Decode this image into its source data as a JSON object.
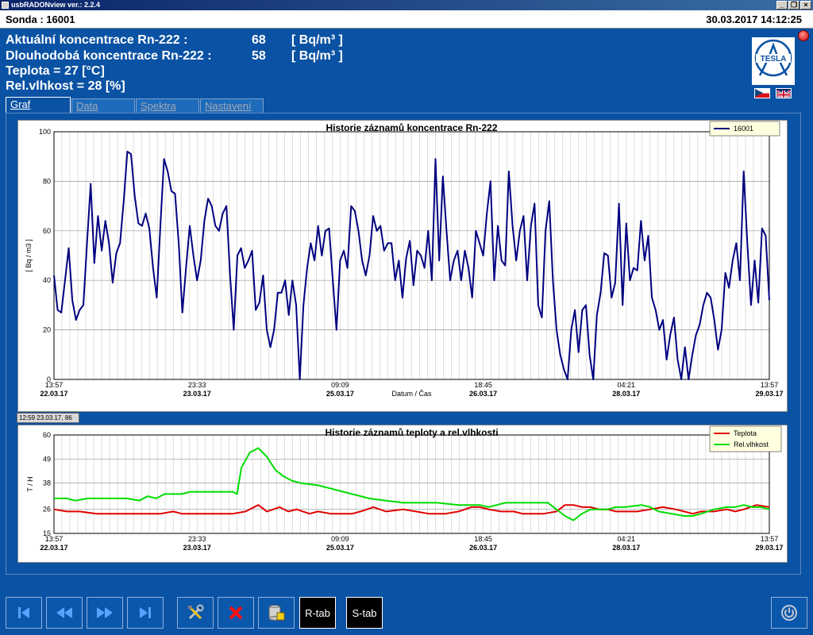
{
  "window": {
    "title": "usbRADONview ver.: 2.2.4",
    "min": "_",
    "restore": "❐",
    "close": "×"
  },
  "info": {
    "sonda": "Sonda : 16001",
    "datetime": "30.03.2017 14:12:25"
  },
  "readings": {
    "rn_actual": {
      "label": "Aktuální koncentrace Rn-222 :",
      "value": "68",
      "unit": "[ Bq/m³ ]"
    },
    "rn_longterm": {
      "label": "Dlouhodobá koncentrace Rn-222 :",
      "value": "58",
      "unit": "[ Bq/m³ ]"
    },
    "temperature": "Teplota = 27  [°C]",
    "humidity": "Rel.vlhkost = 28  [%]"
  },
  "logo": {
    "text": "TESLA"
  },
  "tabs": [
    {
      "label": "Graf",
      "active": true
    },
    {
      "label": "Data",
      "active": false
    },
    {
      "label": "Spektra",
      "active": false
    },
    {
      "label": "Nastavení",
      "active": false
    }
  ],
  "status_readout": "12:59 23.03.17, 86",
  "buttons": {
    "r_tab": "R-tab",
    "s_tab": "S-tab"
  },
  "colors": {
    "panel": "#0a52a3",
    "radon_line": "#000080",
    "temp_line": "#e00000",
    "hum_line": "#00dd00"
  },
  "chart_data": [
    {
      "type": "line",
      "title": "Historie záznamů koncentrace Rn-222",
      "ylabel": "[ Bq / m3 ]",
      "xlabel": "Datum / Čas",
      "ylim": [
        0,
        100
      ],
      "yticks": [
        0,
        20,
        40,
        60,
        80,
        100
      ],
      "xlim": [
        0,
        168
      ],
      "xticks": [
        {
          "pos": 0,
          "time": "13:57",
          "date": "22.03.17"
        },
        {
          "pos": 33.6,
          "time": "23:33",
          "date": "23.03.17"
        },
        {
          "pos": 67.2,
          "time": "09:09",
          "date": "25.03.17"
        },
        {
          "pos": 100.8,
          "time": "18:45",
          "date": "26.03.17"
        },
        {
          "pos": 134.4,
          "time": "04:21",
          "date": "28.03.17"
        },
        {
          "pos": 168,
          "time": "13:57",
          "date": "29.03.17"
        }
      ],
      "legend": "top-right",
      "grid": true,
      "series": [
        {
          "name": "16001",
          "color": "#000080",
          "values": [
            42,
            28,
            27,
            40,
            53,
            32,
            24,
            28,
            30,
            55,
            79,
            47,
            66,
            52,
            64,
            55,
            39,
            51,
            55,
            72,
            92,
            91,
            74,
            63,
            62,
            67,
            61,
            45,
            33,
            62,
            89,
            84,
            76,
            75,
            55,
            27,
            45,
            62,
            50,
            40,
            48,
            64,
            73,
            70,
            62,
            60,
            67,
            70,
            42,
            20,
            50,
            53,
            45,
            48,
            52,
            28,
            31,
            42,
            20,
            13,
            20,
            35,
            35,
            40,
            26,
            40,
            30,
            0,
            30,
            45,
            55,
            48,
            62,
            50,
            60,
            61,
            40,
            20,
            48,
            52,
            45,
            70,
            68,
            60,
            48,
            42,
            50,
            66,
            60,
            62,
            52,
            55,
            55,
            40,
            48,
            33,
            49,
            56,
            38,
            52,
            50,
            45,
            60,
            40,
            89,
            48,
            82,
            60,
            40,
            48,
            52,
            40,
            52,
            45,
            33,
            60,
            55,
            50,
            67,
            80,
            40,
            62,
            48,
            46,
            84,
            62,
            48,
            60,
            66,
            40,
            62,
            71,
            30,
            25,
            60,
            72,
            40,
            20,
            10,
            4,
            0,
            20,
            28,
            11,
            28,
            30,
            10,
            0,
            26,
            35,
            51,
            50,
            33,
            39,
            71,
            30,
            63,
            40,
            45,
            44,
            64,
            48,
            58,
            33,
            28,
            20,
            24,
            8,
            18,
            25,
            8,
            0,
            13,
            0,
            10,
            18,
            22,
            30,
            35,
            33,
            24,
            12,
            20,
            43,
            37,
            48,
            55,
            40,
            84,
            55,
            30,
            48,
            31,
            61,
            58,
            32
          ]
        }
      ]
    },
    {
      "type": "line",
      "title": "Historie záznamů teploty a rel.vlhkosti",
      "ylabel": "T / H",
      "ylim": [
        15,
        60
      ],
      "yticks": [
        15,
        26,
        38,
        49,
        60
      ],
      "xlim": [
        0,
        168
      ],
      "xticks": [
        {
          "pos": 0,
          "time": "13:57",
          "date": "22.03.17"
        },
        {
          "pos": 33.6,
          "time": "23:33",
          "date": "23.03.17"
        },
        {
          "pos": 67.2,
          "time": "09:09",
          "date": "25.03.17"
        },
        {
          "pos": 100.8,
          "time": "18:45",
          "date": "26.03.17"
        },
        {
          "pos": 134.4,
          "time": "04:21",
          "date": "28.03.17"
        },
        {
          "pos": 168,
          "time": "13:57",
          "date": "29.03.17"
        }
      ],
      "legend": "top-right",
      "grid": true,
      "series": [
        {
          "name": "Teplota",
          "color": "#e00000",
          "points": [
            [
              0,
              26
            ],
            [
              3,
              25
            ],
            [
              6,
              25
            ],
            [
              10,
              24
            ],
            [
              15,
              24
            ],
            [
              20,
              24
            ],
            [
              25,
              24
            ],
            [
              28,
              25
            ],
            [
              30,
              24
            ],
            [
              33,
              24
            ],
            [
              38,
              24
            ],
            [
              42,
              24
            ],
            [
              45,
              25
            ],
            [
              48,
              28
            ],
            [
              50,
              25
            ],
            [
              53,
              27
            ],
            [
              55,
              25
            ],
            [
              57,
              26
            ],
            [
              60,
              24
            ],
            [
              62,
              25
            ],
            [
              65,
              24
            ],
            [
              70,
              24
            ],
            [
              72,
              25
            ],
            [
              75,
              27
            ],
            [
              78,
              25
            ],
            [
              82,
              26
            ],
            [
              85,
              25
            ],
            [
              88,
              24
            ],
            [
              92,
              24
            ],
            [
              95,
              25
            ],
            [
              98,
              27
            ],
            [
              100,
              27
            ],
            [
              102,
              26
            ],
            [
              105,
              25
            ],
            [
              108,
              25
            ],
            [
              110,
              24
            ],
            [
              112,
              24
            ],
            [
              115,
              24
            ],
            [
              118,
              25
            ],
            [
              120,
              28
            ],
            [
              122,
              28
            ],
            [
              124,
              27
            ],
            [
              126,
              27
            ],
            [
              128,
              26
            ],
            [
              130,
              26
            ],
            [
              132,
              25
            ],
            [
              134,
              25
            ],
            [
              137,
              25
            ],
            [
              140,
              26
            ],
            [
              143,
              27
            ],
            [
              146,
              26
            ],
            [
              148,
              25
            ],
            [
              150,
              24
            ],
            [
              152,
              25
            ],
            [
              155,
              25
            ],
            [
              158,
              26
            ],
            [
              160,
              25
            ],
            [
              162,
              26
            ],
            [
              165,
              28
            ],
            [
              168,
              27
            ]
          ]
        },
        {
          "name": "Rel.vlhkost",
          "color": "#00dd00",
          "points": [
            [
              0,
              31
            ],
            [
              3,
              31
            ],
            [
              5,
              30
            ],
            [
              8,
              31
            ],
            [
              12,
              31
            ],
            [
              15,
              31
            ],
            [
              17,
              31
            ],
            [
              20,
              30
            ],
            [
              22,
              32
            ],
            [
              24,
              31
            ],
            [
              26,
              33
            ],
            [
              30,
              33
            ],
            [
              32,
              34
            ],
            [
              36,
              34
            ],
            [
              38,
              34
            ],
            [
              40,
              34
            ],
            [
              42,
              34
            ],
            [
              43,
              33
            ],
            [
              44,
              45
            ],
            [
              46,
              52
            ],
            [
              48,
              54
            ],
            [
              50,
              50
            ],
            [
              52,
              44
            ],
            [
              54,
              41
            ],
            [
              56,
              39
            ],
            [
              58,
              38
            ],
            [
              62,
              37
            ],
            [
              66,
              35
            ],
            [
              70,
              33
            ],
            [
              74,
              31
            ],
            [
              78,
              30
            ],
            [
              82,
              29
            ],
            [
              86,
              29
            ],
            [
              90,
              29
            ],
            [
              95,
              28
            ],
            [
              98,
              28
            ],
            [
              100,
              28
            ],
            [
              102,
              27
            ],
            [
              104,
              28
            ],
            [
              106,
              29
            ],
            [
              110,
              29
            ],
            [
              114,
              29
            ],
            [
              116,
              29
            ],
            [
              118,
              26
            ],
            [
              120,
              23
            ],
            [
              122,
              21
            ],
            [
              124,
              24
            ],
            [
              126,
              26
            ],
            [
              128,
              26
            ],
            [
              130,
              26
            ],
            [
              132,
              27
            ],
            [
              134,
              27
            ],
            [
              138,
              28
            ],
            [
              140,
              27
            ],
            [
              142,
              25
            ],
            [
              145,
              24
            ],
            [
              148,
              23
            ],
            [
              150,
              23
            ],
            [
              152,
              24
            ],
            [
              155,
              26
            ],
            [
              158,
              27
            ],
            [
              160,
              27
            ],
            [
              162,
              28
            ],
            [
              164,
              27
            ],
            [
              166,
              27
            ],
            [
              168,
              26
            ]
          ]
        }
      ]
    }
  ]
}
